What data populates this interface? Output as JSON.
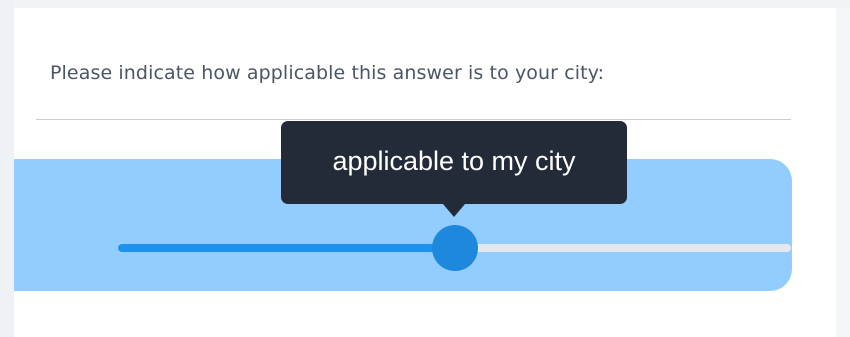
{
  "question": {
    "prompt": "Please indicate how applicable this answer is to your city:"
  },
  "slider": {
    "value_fraction": 0.5,
    "tooltip_label": "applicable to my city"
  },
  "colors": {
    "panel": "#93ccff",
    "track_fill": "#1b93ee",
    "track_rest": "#e4e8ee",
    "thumb": "#1e89dc",
    "tooltip_bg": "#232b38"
  }
}
